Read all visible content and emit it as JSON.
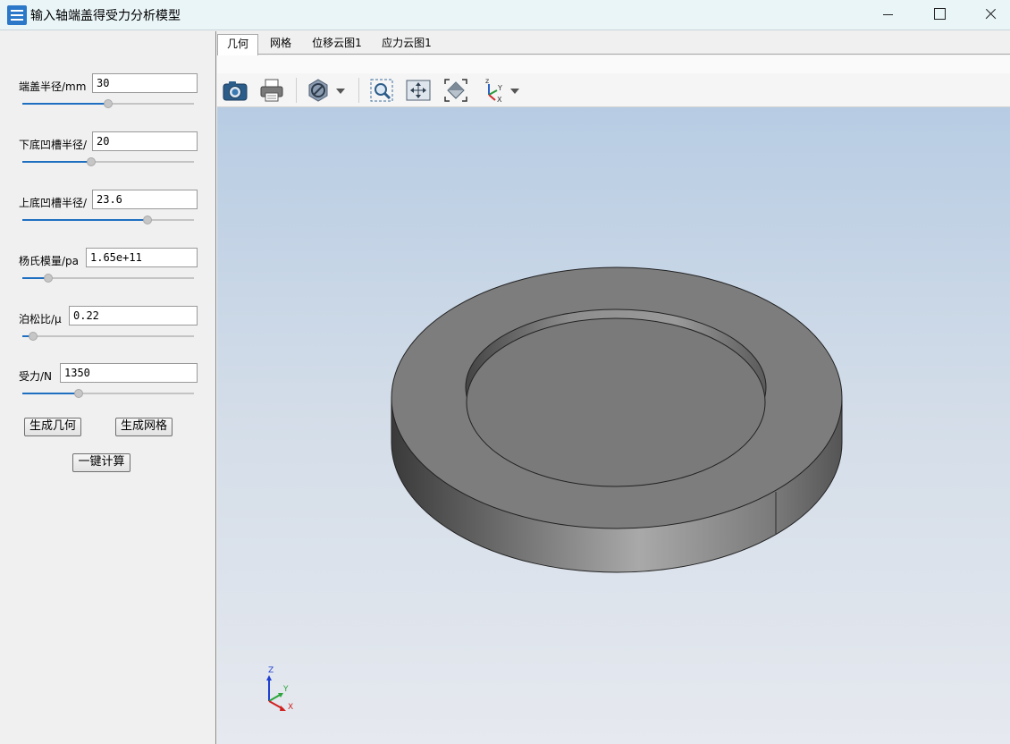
{
  "window": {
    "title": "输入轴端盖得受力分析模型",
    "icons": [
      "app-icon",
      "minimize-icon",
      "maximize-icon",
      "close-icon"
    ]
  },
  "params": [
    {
      "label": "端盖半径/mm",
      "value": "30",
      "slider_fraction": 0.5
    },
    {
      "label": "下底凹槽半径/",
      "value": "20",
      "slider_fraction": 0.4
    },
    {
      "label": "上底凹槽半径/",
      "value": "23.6",
      "slider_fraction": 0.73
    },
    {
      "label": "杨氏模量/pa",
      "value": "1.65e+11",
      "slider_fraction": 0.15
    },
    {
      "label": "泊松比/μ",
      "value": "0.22",
      "slider_fraction": 0.06
    },
    {
      "label": "受力/N",
      "value": "1350",
      "slider_fraction": 0.33
    }
  ],
  "buttons": {
    "generate_geometry": "生成几何",
    "generate_mesh": "生成网格",
    "compute": "一键计算"
  },
  "tabs": [
    {
      "label": "几何",
      "active": true
    },
    {
      "label": "网格",
      "active": false
    },
    {
      "label": "位移云图1",
      "active": false
    },
    {
      "label": "应力云图1",
      "active": false
    }
  ],
  "toolbar": {
    "tools": [
      "camera-icon",
      "print-icon",
      "display-mode-icon",
      "dropdown-arrow-icon",
      "zoom-box-icon",
      "pan-icon",
      "fit-all-icon",
      "view-orientation-icon",
      "dropdown-arrow-icon"
    ]
  },
  "triad": {
    "z": "Z",
    "y": "Y",
    "x": "X"
  },
  "colors": {
    "accent": "#1f6fc0",
    "model_top": "#7d7d7d",
    "viewport_top": "#b7cce3",
    "viewport_bottom": "#e6e9ef"
  }
}
